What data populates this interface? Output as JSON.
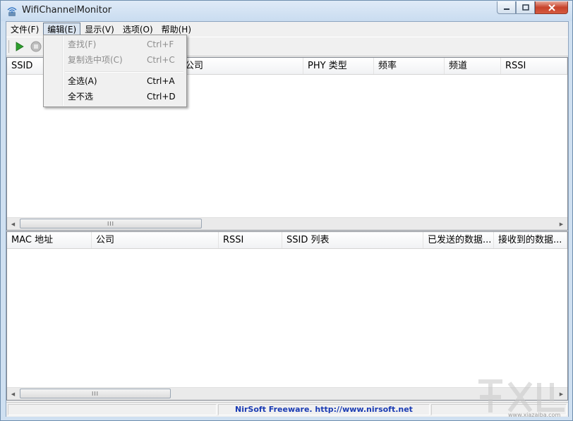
{
  "window": {
    "title": "WifiChannelMonitor"
  },
  "menubar": {
    "items": [
      "文件(F)",
      "编辑(E)",
      "显示(V)",
      "选项(O)",
      "帮助(H)"
    ],
    "active_index": 1
  },
  "toolbar": {
    "buttons": [
      {
        "name": "start-icon",
        "color": "#2e9e2e"
      },
      {
        "name": "stop-icon",
        "color": "#a8a8a8"
      }
    ]
  },
  "edit_menu": {
    "items": [
      {
        "label": "查找(F)",
        "shortcut": "Ctrl+F",
        "enabled": false
      },
      {
        "label": "复制选中项(C)",
        "shortcut": "Ctrl+C",
        "enabled": false
      },
      {
        "label": "全选(A)",
        "shortcut": "Ctrl+A",
        "enabled": true
      },
      {
        "label": "全不选",
        "shortcut": "Ctrl+D",
        "enabled": true
      }
    ]
  },
  "top_list": {
    "columns": [
      "SSID",
      "公司",
      "PHY 类型",
      "频率",
      "频道",
      "RSSI"
    ],
    "rows": []
  },
  "bottom_list": {
    "columns": [
      "MAC 地址",
      "公司",
      "RSSI",
      "SSID 列表",
      "已发送的数据...",
      "接收到的数据..."
    ],
    "rows": []
  },
  "statusbar": {
    "text": "NirSoft Freeware.  http://www.nirsoft.net"
  },
  "watermark": {
    "text": "www.xiazaiba.com"
  },
  "colors": {
    "status_link": "#1a3bb3",
    "close_button": "#c7432c"
  }
}
